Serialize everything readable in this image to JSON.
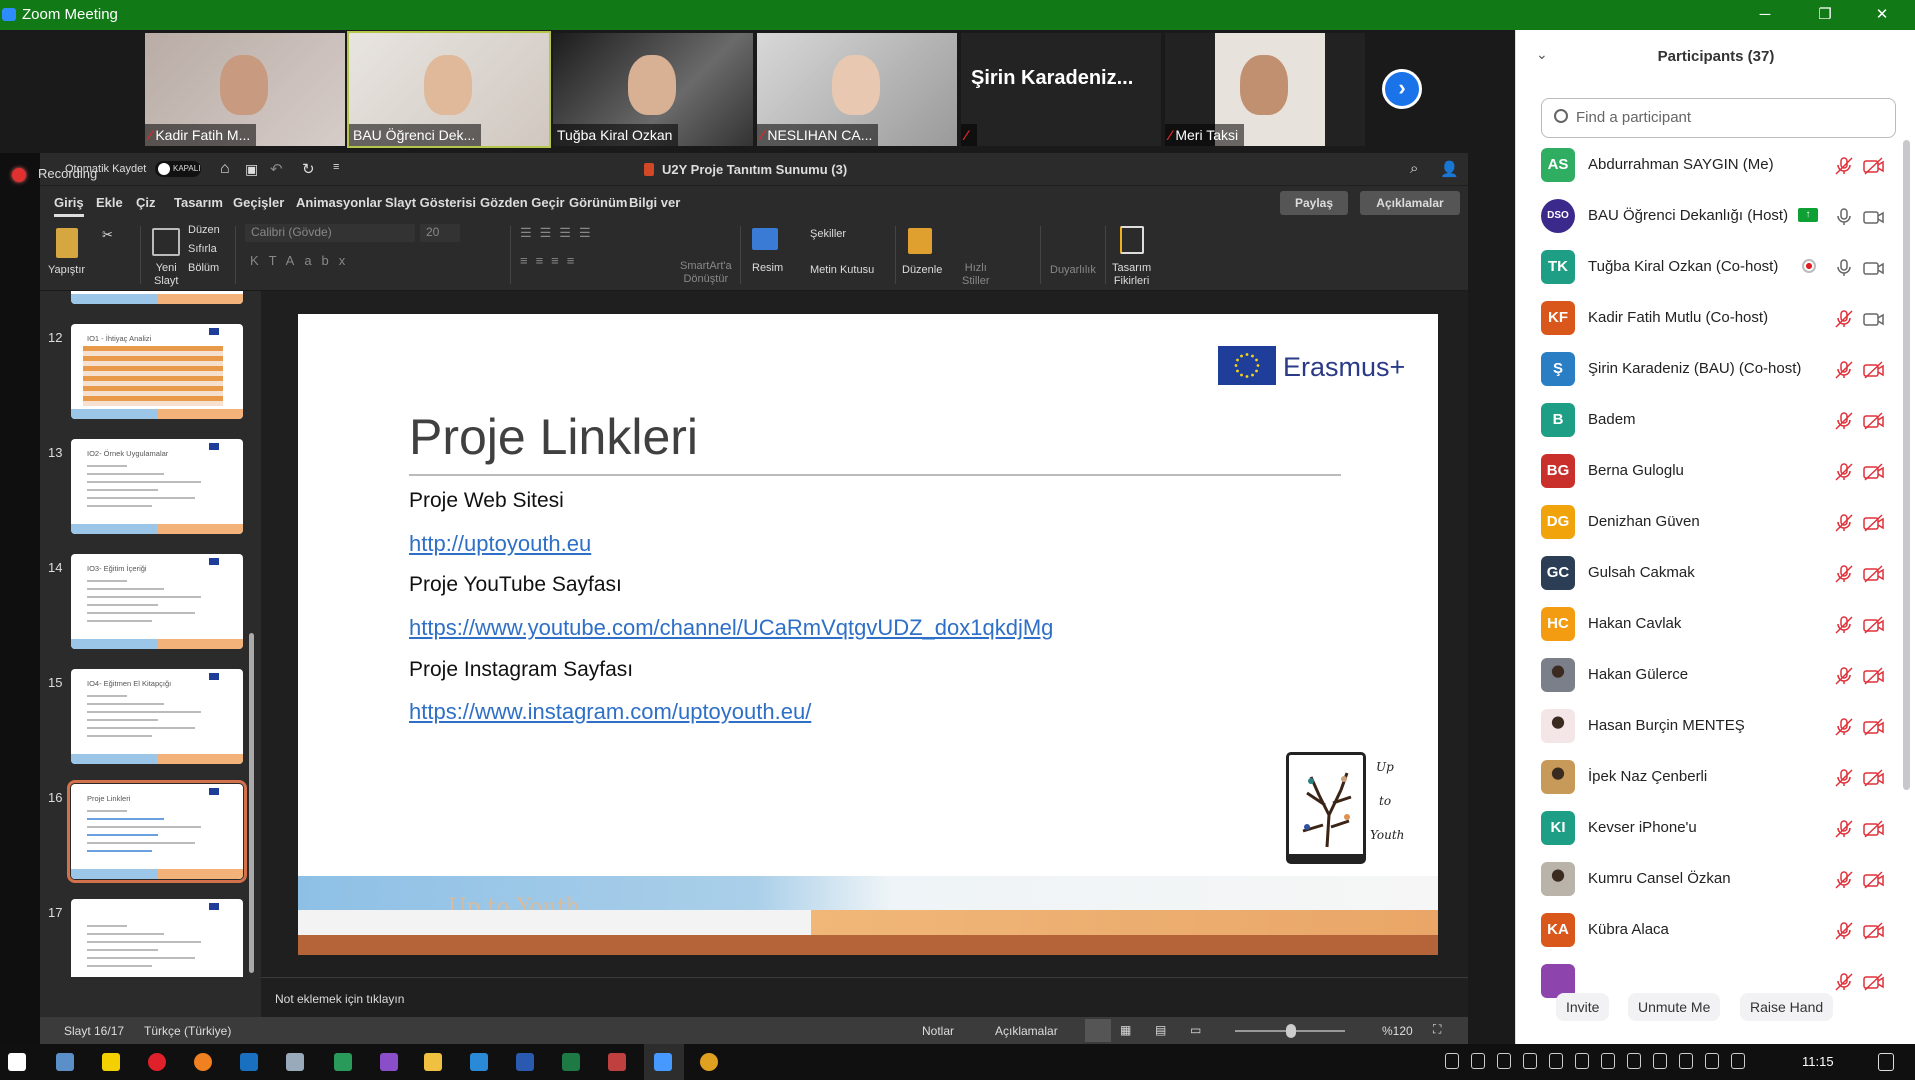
{
  "window": {
    "title": "Zoom Meeting",
    "minimize": "─",
    "restore": "❐",
    "close": "✕"
  },
  "recording": "Recording",
  "video_tiles": [
    {
      "name": "Kadir Fatih M...",
      "muted": true
    },
    {
      "name": "BAU Öğrenci Dek...",
      "muted": false,
      "active": true
    },
    {
      "name": "Tuğba Kiral Ozkan",
      "muted": false
    },
    {
      "name": "NESLIHAN CA...",
      "muted": true
    },
    {
      "name": "",
      "display_text": "Şirin  Karadeniz...",
      "muted": true
    },
    {
      "name": "Meri Taksi",
      "muted": true
    }
  ],
  "next_arrow": "›",
  "ppt": {
    "autosave": "Otomatik Kaydet",
    "autosave_state": "KAPALI",
    "doc_title": "U2Y Proje Tanıtım Sunumu (3)",
    "tabs": [
      "Giriş",
      "Ekle",
      "Çiz",
      "Tasarım",
      "Geçişler",
      "Animasyonlar",
      "Slayt Gösterisi",
      "Gözden Geçir",
      "Görünüm",
      "Bilgi ver"
    ],
    "share": "Paylaş",
    "comments": "Açıklamalar",
    "ribbon": {
      "paste": "Yapıştır",
      "new_slide_1": "Yeni",
      "new_slide_2": "Slayt",
      "layout": "Düzen",
      "reset": "Sıfırla",
      "section": "Bölüm",
      "font": "Calibri (Gövde)",
      "size": "20",
      "smartart_1": "SmartArt'a",
      "smartart_2": "Dönüştür",
      "picture": "Resim",
      "shapes": "Şekiller",
      "textbox": "Metin Kutusu",
      "arrange": "Düzenle",
      "quick_1": "Hızlı",
      "quick_2": "Stiller",
      "sensitivity": "Duyarlılık",
      "designer_1": "Tasarım",
      "designer_2": "Fikirleri"
    },
    "thumbnails": [
      {
        "num": "",
        "title": ""
      },
      {
        "num": "12",
        "title": "IO1 - İhtiyaç Analizi"
      },
      {
        "num": "13",
        "title": "IO2- Örnek Uygulamalar"
      },
      {
        "num": "14",
        "title": "IO3- Eğitim İçeriği"
      },
      {
        "num": "15",
        "title": "IO4- Eğitmen El Kitapçığı"
      },
      {
        "num": "16",
        "title": "Proje Linkleri",
        "selected": true
      },
      {
        "num": "17",
        "title": ""
      }
    ],
    "slide": {
      "title": "Proje Linkleri",
      "lines": [
        {
          "type": "text",
          "text": "Proje Web Sitesi"
        },
        {
          "type": "link",
          "text": "http://uptoyouth.eu"
        },
        {
          "type": "text",
          "text": "Proje YouTube Sayfası"
        },
        {
          "type": "link",
          "text": "https://www.youtube.com/channel/UCaRmVqtgvUDZ_dox1qkdjMg"
        },
        {
          "type": "text",
          "text": "Proje Instagram Sayfası"
        },
        {
          "type": "link",
          "text": "https://www.instagram.com/uptoyouth.eu/"
        }
      ],
      "erasmus": "Erasmus+",
      "logo_words": [
        "Up",
        "to",
        "Youth"
      ],
      "banner": "Up to Youth"
    },
    "notes_placeholder": "Not eklemek için tıklayın",
    "status": {
      "slide": "Slayt 16/17",
      "language": "Türkçe (Türkiye)",
      "notes": "Notlar",
      "comments": "Açıklamalar",
      "zoom": "%120",
      "zoom_level": 120
    }
  },
  "participants": {
    "title": "Participants (37)",
    "search_placeholder": "Find a participant",
    "list": [
      {
        "initials": "AS",
        "name": "Abdurrahman SAYGIN (Me)",
        "color": "#2fae62",
        "mic": "muted",
        "cam": "off"
      },
      {
        "initials": "DSO",
        "name": "BAU Öğrenci Dekanlığı (Host)",
        "color": "#3b2a8c",
        "mic": "on",
        "cam": "on",
        "badge": "share"
      },
      {
        "initials": "TK",
        "name": "Tuğba Kiral Ozkan (Co-host)",
        "color": "#1f9e86",
        "mic": "on",
        "cam": "on",
        "badge": "record"
      },
      {
        "initials": "KF",
        "name": "Kadir Fatih Mutlu (Co-host)",
        "color": "#d9571a",
        "mic": "muted",
        "cam": "on"
      },
      {
        "initials": "Ş",
        "name": "Şirin Karadeniz (BAU) (Co-host)",
        "color": "#2a7fc4",
        "mic": "muted",
        "cam": "off"
      },
      {
        "initials": "B",
        "name": "Badem",
        "color": "#1f9e86",
        "mic": "muted",
        "cam": "off"
      },
      {
        "initials": "BG",
        "name": "Berna Guloglu",
        "color": "#c9302c",
        "mic": "muted",
        "cam": "off"
      },
      {
        "initials": "DG",
        "name": "Denizhan Güven",
        "color": "#f0a30a",
        "mic": "muted",
        "cam": "off"
      },
      {
        "initials": "GC",
        "name": "Gulsah Cakmak",
        "color": "#2c3e55",
        "mic": "muted",
        "cam": "off"
      },
      {
        "initials": "HC",
        "name": "Hakan Cavlak",
        "color": "#f39c12",
        "mic": "muted",
        "cam": "off"
      },
      {
        "initials": "",
        "name": "Hakan Gülerce",
        "color": "#7a7f8a",
        "mic": "muted",
        "cam": "off",
        "photo": true
      },
      {
        "initials": "",
        "name": "Hasan Burçin MENTEŞ",
        "color": "#f4e6e6",
        "mic": "muted",
        "cam": "off",
        "photo": true
      },
      {
        "initials": "",
        "name": "İpek Naz Çenberli",
        "color": "#c89a5a",
        "mic": "muted",
        "cam": "off",
        "photo": true
      },
      {
        "initials": "KI",
        "name": "Kevser iPhone'u",
        "color": "#1f9e86",
        "mic": "muted",
        "cam": "off"
      },
      {
        "initials": "",
        "name": "Kumru Cansel Özkan",
        "color": "#b9b3aa",
        "mic": "muted",
        "cam": "off",
        "photo": true
      },
      {
        "initials": "KA",
        "name": "Kübra Alaca",
        "color": "#d9571a",
        "mic": "muted",
        "cam": "off"
      },
      {
        "initials": "",
        "name": "",
        "color": "#8e44ad",
        "mic": "muted",
        "cam": "off"
      }
    ],
    "buttons": [
      "Invite",
      "Unmute Me",
      "Raise Hand"
    ]
  },
  "taskbar": {
    "time": "11:15"
  }
}
